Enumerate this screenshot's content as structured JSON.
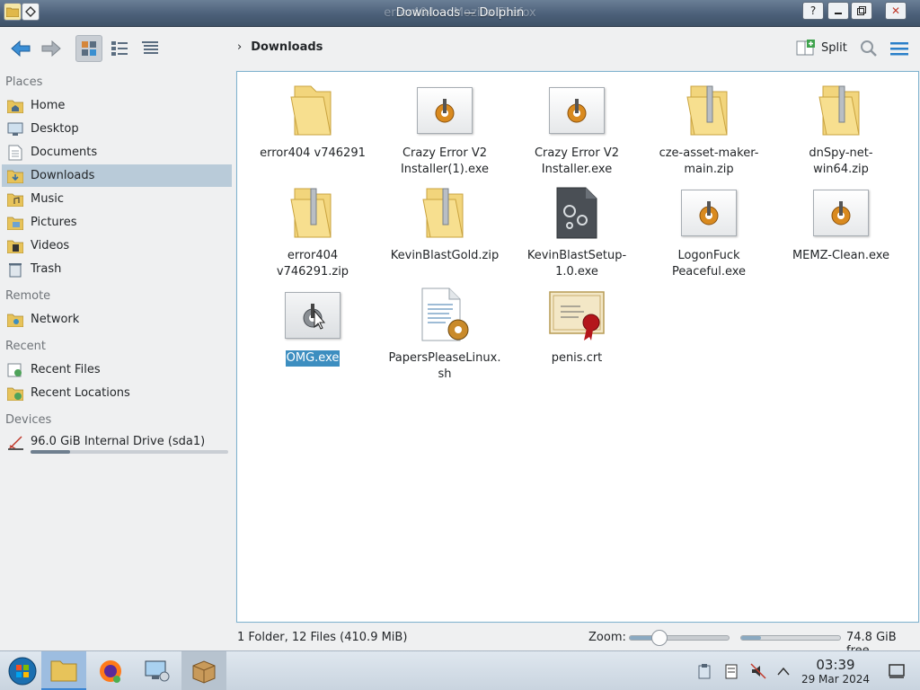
{
  "window": {
    "title": "Downloads — Dolphin",
    "background_title": "error404 — Mozilla Firefox"
  },
  "toolbar": {
    "breadcrumb": "Downloads",
    "split_label": "Split"
  },
  "sidebar": {
    "sections": [
      {
        "title": "Places",
        "items": [
          "Home",
          "Desktop",
          "Documents",
          "Downloads",
          "Music",
          "Pictures",
          "Videos",
          "Trash"
        ]
      },
      {
        "title": "Remote",
        "items": [
          "Network"
        ]
      },
      {
        "title": "Recent",
        "items": [
          "Recent Files",
          "Recent Locations"
        ]
      },
      {
        "title": "Devices",
        "items": [
          "96.0 GiB Internal Drive (sda1)"
        ]
      }
    ],
    "active_item": "Downloads",
    "drive_usage_fraction": 0.2
  },
  "files": [
    {
      "name": "error404 v746291",
      "type": "folder"
    },
    {
      "name": "Crazy Error V2 Installer(1).exe",
      "type": "exe"
    },
    {
      "name": "Crazy Error V2 Installer.exe",
      "type": "exe"
    },
    {
      "name": "cze-asset-maker-main.zip",
      "type": "zip"
    },
    {
      "name": "dnSpy-net-win64.zip",
      "type": "zip"
    },
    {
      "name": "error404 v746291.zip",
      "type": "zip"
    },
    {
      "name": "KevinBlastGold.zip",
      "type": "zip"
    },
    {
      "name": "KevinBlastSetup-1.0.exe",
      "type": "exe-dark"
    },
    {
      "name": "LogonFuck Peaceful.exe",
      "type": "exe"
    },
    {
      "name": "MEMZ-Clean.exe",
      "type": "exe"
    },
    {
      "name": "OMG.exe",
      "type": "exe-gray",
      "selected": true
    },
    {
      "name": "PapersPleaseLinux.sh",
      "type": "script"
    },
    {
      "name": "penis.crt",
      "type": "certificate"
    }
  ],
  "status": {
    "summary": "1 Folder, 12 Files (410.9 MiB)",
    "zoom_label": "Zoom:",
    "zoom_fraction": 0.3,
    "free_space": "74.8 GiB free",
    "disk_used_fraction": 0.2
  },
  "taskbar": {
    "time": "03:39",
    "date": "29 Mar 2024"
  },
  "colors": {
    "accent": "#3d8ec0",
    "sidebar_active": "#b9cbd9",
    "view_border": "#7fb2cd"
  }
}
